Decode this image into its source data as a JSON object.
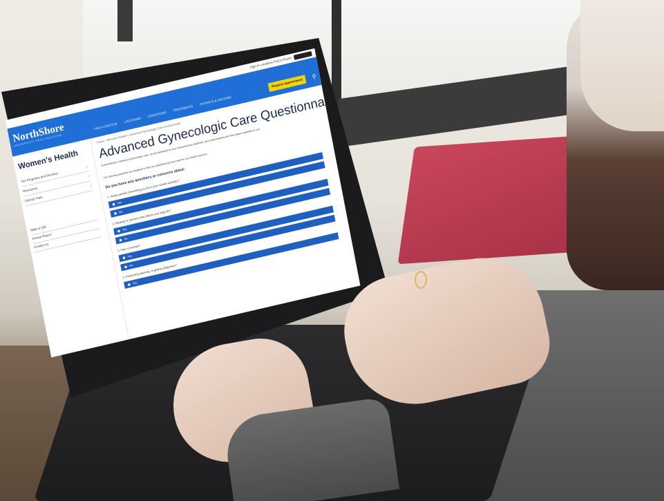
{
  "site": {
    "logo": "NorthShore",
    "logo_sub": "UNIVERSITY HEALTHSYSTEM",
    "top_links": "Sign In  Locations  Find a Doctor",
    "nav_links": [
      "FIND A DOCTOR",
      "LOCATIONS",
      "CONDITIONS",
      "TREATMENTS",
      "PATIENTS & VISITORS"
    ],
    "appointment_button": "Request Appointment"
  },
  "sidebar": {
    "title": "Women's Health",
    "items": [
      {
        "label": "Our Programs and Services"
      },
      {
        "label": "Resources"
      },
      {
        "label": "Clinical Trials"
      },
      {
        "label": "Make a Gift"
      },
      {
        "label": "Annual Report"
      },
      {
        "label": "Contact Us"
      }
    ]
  },
  "main": {
    "breadcrumb": "Home > Women's Health > Advanced Gynecologic Care Questionnaire",
    "title": "Advanced Gynecologic Care Questionnaire",
    "intro": "At NorthShore's Advanced Gynecologic Care, we are dedicated to your comprehensive treatment, and understanding all of the options available to you.",
    "intro2": "The following questions are designed to help you determine the best care for your health concerns.",
    "prompt": "Do you have any questions or concerns about:",
    "questions": [
      {
        "text": "1. Heavy periods preventing you from your normal activities?",
        "options": [
          "Yes",
          "No"
        ]
      },
      {
        "text": "2. Bloating or pressure that affects your daily life?",
        "options": [
          "Yes",
          "No"
        ]
      },
      {
        "text": "3. Pain or cramps?",
        "options": [
          "Yes",
          "No"
        ]
      },
      {
        "text": "4. Preventing planning, or getting pregnancy?",
        "options": [
          "Yes"
        ]
      }
    ]
  },
  "colors": {
    "nav_blue": "#1f6fd6",
    "option_blue": "#1f5fbf",
    "appointment_yellow": "#f4d20f"
  }
}
